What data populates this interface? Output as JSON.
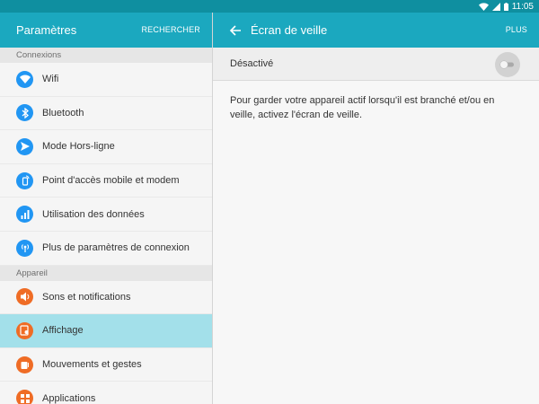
{
  "status_bar": {
    "time": "11:05",
    "icons": [
      "wifi-icon",
      "signal-icon",
      "battery-icon"
    ]
  },
  "left_header": {
    "title": "Paramètres",
    "search_label": "RECHERCHER"
  },
  "right_header": {
    "title": "Écran de veille",
    "more_label": "PLUS"
  },
  "sections": [
    {
      "title": "Connexions",
      "items": [
        {
          "label": "Wifi",
          "icon": "wifi-icon",
          "color": "#2196f3"
        },
        {
          "label": "Bluetooth",
          "icon": "bluetooth-icon",
          "color": "#2196f3"
        },
        {
          "label": "Mode Hors-ligne",
          "icon": "airplane-icon",
          "color": "#2196f3"
        },
        {
          "label": "Point d'accès mobile et modem",
          "icon": "hotspot-icon",
          "color": "#2196f3"
        },
        {
          "label": "Utilisation des données",
          "icon": "data-usage-icon",
          "color": "#2196f3"
        },
        {
          "label": "Plus de paramètres de connexion",
          "icon": "connection-icon",
          "color": "#2196f3"
        }
      ]
    },
    {
      "title": "Appareil",
      "items": [
        {
          "label": "Sons et notifications",
          "icon": "speaker-icon",
          "color": "#ef6c25"
        },
        {
          "label": "Affichage",
          "icon": "display-icon",
          "color": "#ef6c25",
          "active": true
        },
        {
          "label": "Mouvements et gestes",
          "icon": "gesture-icon",
          "color": "#ef6c25"
        },
        {
          "label": "Applications",
          "icon": "apps-icon",
          "color": "#ef6c25"
        }
      ]
    }
  ],
  "screensaver": {
    "toggle_label": "Désactivé",
    "toggle_state": "off",
    "description": "Pour garder votre appareil actif lorsqu'il est branché et/ou en veille, activez l'écran de veille."
  },
  "colors": {
    "status_bar": "#0f8fa0",
    "app_bar": "#1ba8bf",
    "active_item": "#a3e0ea",
    "connections_icon": "#2196f3",
    "device_icon": "#ef6c25"
  }
}
